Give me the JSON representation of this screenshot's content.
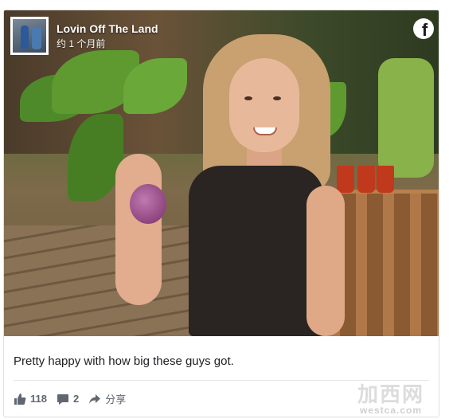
{
  "post": {
    "page_name": "Lovin Off The Land",
    "timestamp": "约 1 个月前",
    "caption": "Pretty happy with how big these guys got.",
    "brand_icon": "facebook-icon"
  },
  "actions": {
    "like_count": "118",
    "comment_count": "2",
    "share_label": "分享"
  },
  "watermark": {
    "cn": "加西网",
    "en": "westca.com"
  },
  "colors": {
    "text": "#1c1e21",
    "muted": "#606770",
    "border": "#dddfe2"
  }
}
